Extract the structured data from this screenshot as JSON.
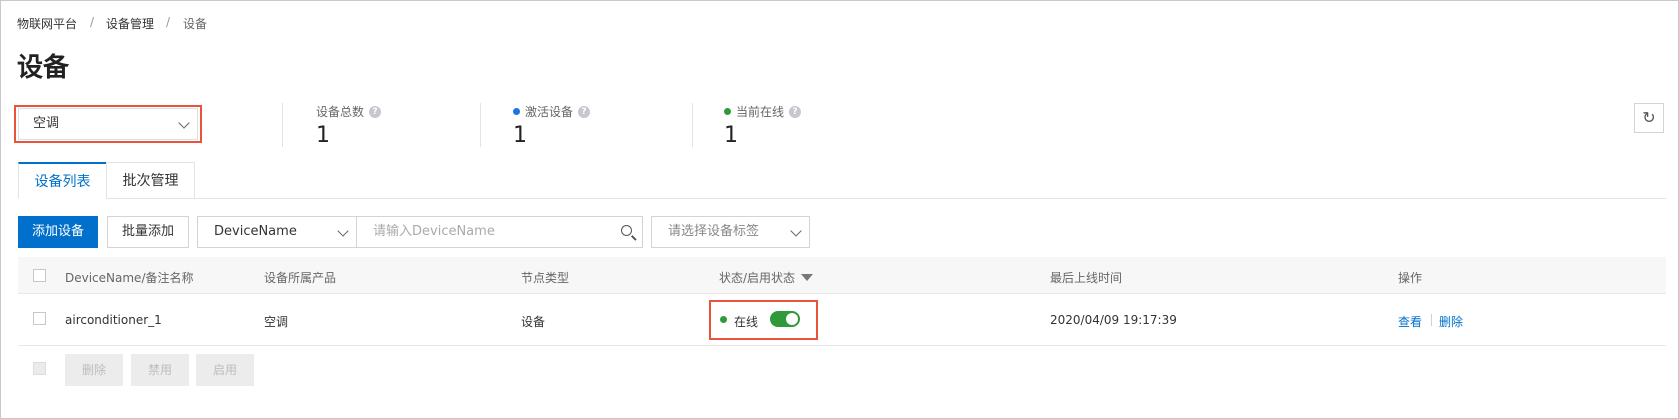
{
  "breadcrumb": {
    "items": [
      "物联网平台",
      "设备管理",
      "设备"
    ],
    "separator": "/"
  },
  "page": {
    "title": "设备"
  },
  "product_select": {
    "value": "空调"
  },
  "stats": {
    "total": {
      "label": "设备总数",
      "value": "1"
    },
    "activated": {
      "label": "激活设备",
      "value": "1",
      "dot_color": "#1a73e8"
    },
    "online": {
      "label": "当前在线",
      "value": "1",
      "dot_color": "#2e9a3a"
    },
    "help_glyph": "?"
  },
  "refresh": {
    "icon": "refresh-icon",
    "glyph": "↻"
  },
  "tabs": [
    {
      "label": "设备列表",
      "active": true
    },
    {
      "label": "批次管理",
      "active": false
    }
  ],
  "toolbar": {
    "add_label": "添加设备",
    "batch_add_label": "批量添加",
    "field_select_value": "DeviceName",
    "search_placeholder": "请输入DeviceName",
    "tag_select_placeholder": "请选择设备标签"
  },
  "table": {
    "headers": {
      "name": "DeviceName/备注名称",
      "product": "设备所属产品",
      "node_type": "节点类型",
      "status": "状态/启用状态",
      "last_online": "最后上线时间",
      "actions": "操作"
    },
    "rows": [
      {
        "name": "airconditioner_1",
        "product": "空调",
        "node_type": "设备",
        "status": "在线",
        "enabled": true,
        "last_online": "2020/04/09 19:17:39",
        "actions": [
          "查看",
          "删除"
        ]
      }
    ]
  },
  "bulk_actions": [
    "删除",
    "禁用",
    "启用"
  ],
  "colors": {
    "primary": "#0070cc",
    "online_green": "#2e9a3a",
    "highlight": "#e8543a"
  }
}
